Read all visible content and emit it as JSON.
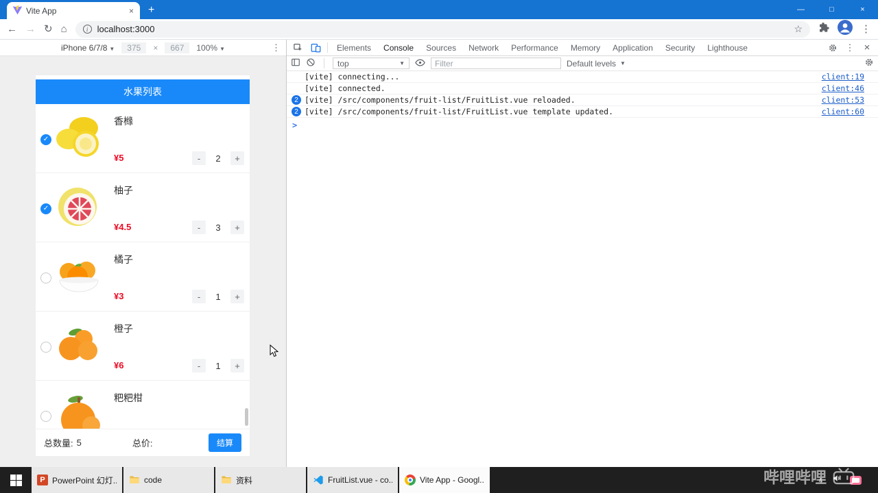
{
  "colors": {
    "titlebar_blue": "#1573d2",
    "app_accent_blue": "#1989fa",
    "price_red": "#ee0a24",
    "repeat_badge_blue": "#1a73e8",
    "console_link_blue": "#1a5cc8",
    "taskbar_dark": "#1f1f1f",
    "bilibili_pink": "#fb7299"
  },
  "glyphs": {
    "back": "←",
    "forward": "→",
    "reload": "↻",
    "home": "⌂",
    "star": "☆",
    "menu_dots": "⋮",
    "minimize": "—",
    "maximize": "□",
    "close": "×",
    "new_tab": "+",
    "caret_down": "▼",
    "caret_small": "▾",
    "chevron_up": "∧",
    "prompt": ">",
    "check": "✓",
    "info": "i"
  },
  "browser": {
    "tab_title": "Vite App",
    "url": "localhost:3000"
  },
  "device_toolbar": {
    "device": "iPhone 6/7/8",
    "width": "375",
    "times": "×",
    "height": "667",
    "zoom": "100%"
  },
  "app": {
    "title": "水果列表",
    "currency": "¥",
    "fruits": [
      {
        "name": "香橼",
        "image": "citron",
        "price": "5",
        "qty": "2",
        "checked": true
      },
      {
        "name": "柚子",
        "image": "pomelo",
        "price": "4.5",
        "qty": "3",
        "checked": true
      },
      {
        "name": "橘子",
        "image": "mandarin",
        "price": "3",
        "qty": "1",
        "checked": false
      },
      {
        "name": "橙子",
        "image": "orange",
        "price": "6",
        "qty": "1",
        "checked": false
      },
      {
        "name": "粑粑柑",
        "image": "papa-citrus",
        "price": "",
        "qty": "",
        "checked": false
      }
    ],
    "stepper": {
      "minus": "-",
      "plus": "+"
    },
    "footer": {
      "total_count_label": "总数量:",
      "total_count": "5",
      "total_price_label": "总价:",
      "total_price": "",
      "checkout_label": "结算"
    }
  },
  "devtools": {
    "tabs": [
      "Elements",
      "Console",
      "Sources",
      "Network",
      "Performance",
      "Memory",
      "Application",
      "Security",
      "Lighthouse"
    ],
    "active_tab": "Console",
    "console_toolbar": {
      "context": "top",
      "filter_placeholder": "Filter",
      "levels": "Default levels"
    },
    "messages": [
      {
        "count": "",
        "text": "[vite] connecting...",
        "link": "client:19"
      },
      {
        "count": "",
        "text": "[vite] connected.",
        "link": "client:46"
      },
      {
        "count": "2",
        "text": "[vite] /src/components/fruit-list/FruitList.vue reloaded.",
        "link": "client:53"
      },
      {
        "count": "2",
        "text": "[vite] /src/components/fruit-list/FruitList.vue template updated.",
        "link": "client:60"
      }
    ]
  },
  "taskbar": {
    "items": [
      {
        "label": "PowerPoint 幻灯...",
        "icon": "powerpoint",
        "active": false
      },
      {
        "label": "code",
        "icon": "folder",
        "active": false
      },
      {
        "label": "资料",
        "icon": "folder",
        "active": false
      },
      {
        "label": "FruitList.vue - co...",
        "icon": "vscode",
        "active": false
      },
      {
        "label": "Vite App - Googl...",
        "icon": "chrome",
        "active": true
      }
    ]
  },
  "watermark": {
    "text": "哔哩哔哩"
  }
}
